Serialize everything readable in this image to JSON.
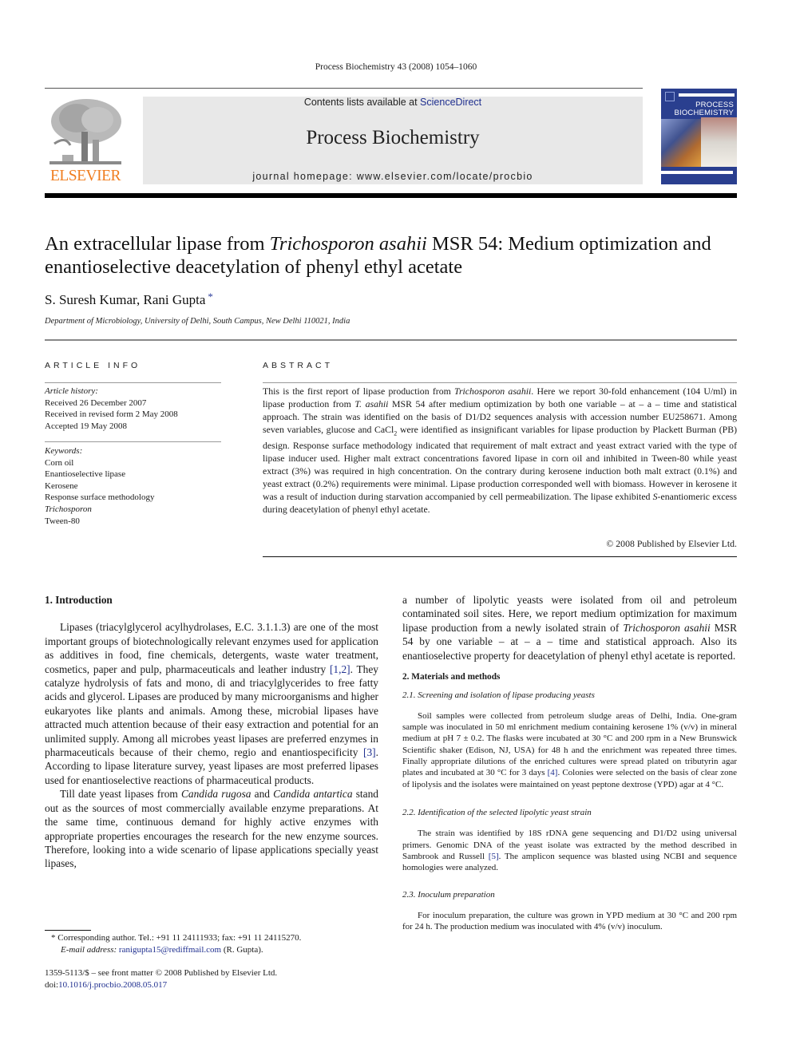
{
  "running_head": "Process Biochemistry 43 (2008) 1054–1060",
  "masthead": {
    "publisher_logo_text": "ELSEVIER",
    "contents_prefix": "Contents lists available at ",
    "contents_link": "ScienceDirect",
    "journal_name": "Process Biochemistry",
    "homepage_label": "journal homepage: www.elsevier.com/locate/procbio",
    "cover": {
      "title_line1": "PROCESS",
      "title_line2": "BIOCHEMISTRY"
    },
    "colors": {
      "elsevier_orange": "#f07d1f",
      "cover_blue": "#2a3f8f",
      "link_blue": "#1f2f8f"
    }
  },
  "article": {
    "title_part1": "An extracellular lipase from ",
    "title_italic": "Trichosporon asahii",
    "title_part2": " MSR 54: Medium optimization and enantioselective deacetylation of phenyl ethyl acetate",
    "authors": "S. Suresh Kumar, Rani Gupta",
    "corresponding_mark": "*",
    "affiliation": "Department of Microbiology, University of Delhi, South Campus, New Delhi 110021, India"
  },
  "article_info": {
    "heading": "ARTICLE INFO",
    "history_label": "Article history:",
    "history": [
      "Received 26 December 2007",
      "Received in revised form 2 May 2008",
      "Accepted 19 May 2008"
    ],
    "keywords_label": "Keywords:",
    "keywords": [
      "Corn oil",
      "Enantioselective lipase",
      "Kerosene",
      "Response surface methodology",
      "Trichosporon",
      "Tween-80"
    ]
  },
  "abstract": {
    "heading": "ABSTRACT",
    "s1": "This is the first report of lipase production from ",
    "s1_it": "Trichosporon asahii",
    "s2": ". Here we report 30-fold enhancement (104 U/ml) in lipase production from ",
    "s2_it": "T. asahii",
    "s3": " MSR 54 after medium optimization by both one variable – at – a – time and statistical approach. The strain was identified on the basis of D1/D2 sequences analysis with accession number EU258671. Among seven variables, glucose and CaCl",
    "s3_sub": "2",
    "s4": " were identified as insignificant variables for lipase production by Plackett Burman (PB) design. Response surface methodology indicated that requirement of malt extract and yeast extract varied with the type of lipase inducer used. Higher malt extract concentrations favored lipase in corn oil and inhibited in Tween-80 while yeast extract (3%) was required in high concentration. On the contrary during kerosene induction both malt extract (0.1%) and yeast extract (0.2%) requirements were minimal. Lipase production corresponded well with biomass. However in kerosene it was a result of induction during starvation accompanied by cell permeabilization. The lipase exhibited ",
    "s4_it": "S",
    "s5": "-enantiomeric excess during deacetylation of phenyl ethyl acetate.",
    "copyright": "© 2008 Published by Elsevier Ltd."
  },
  "body": {
    "intro_heading": "1.  Introduction",
    "intro_p1_a": "Lipases (triacylglycerol acylhydrolases, E.C. 3.1.1.3) are one of the most important groups of biotechnologically relevant enzymes used for application as additives in food, fine chemicals, detergents, waste water treatment, cosmetics, paper and pulp, pharmaceuticals and leather industry ",
    "intro_p1_ref1": "[1,2]",
    "intro_p1_b": ". They catalyze hydrolysis of fats and mono, di and triacylglycerides to free fatty acids and glycerol. Lipases are produced by many microorganisms and higher eukaryotes like plants and animals. Among these, microbial lipases have attracted much attention because of their easy extraction and potential for an unlimited supply. Among all microbes yeast lipases are preferred enzymes in pharmaceuticals because of their chemo, regio and enantiospecificity ",
    "intro_p1_ref2": "[3]",
    "intro_p1_c": ". According to lipase literature survey, yeast lipases are most preferred lipases used for enantioselective reactions of pharmaceutical products.",
    "intro_p2_a": "Till date yeast lipases from ",
    "intro_p2_it1": "Candida rugosa",
    "intro_p2_b": " and ",
    "intro_p2_it2": "Candida antartica",
    "intro_p2_c": " stand out as the sources of most commercially available enzyme preparations. At the same time, continuous demand for highly active enzymes with appropriate properties encourages the research for the new enzyme sources. Therefore, looking into a wide scenario of lipase applications specially yeast lipases,",
    "right_p1_a": "a number of lipolytic yeasts were isolated from oil and petroleum contaminated soil sites. Here, we report medium optimization for maximum lipase production from a newly isolated strain of ",
    "right_p1_it": "Trichosporon asahii",
    "right_p1_b": " MSR 54 by one variable – at – a – time and statistical approach. Also its enantioselective property for deacetylation of phenyl ethyl acetate is reported.",
    "methods_heading": "2.  Materials and methods",
    "sub21_heading": "2.1.  Screening and isolation of lipase producing yeasts",
    "sub21_a": "Soil samples were collected from petroleum sludge areas of Delhi, India. One-gram sample was inoculated in 50 ml enrichment medium containing kerosene 1% (v/v) in mineral medium at pH 7 ± 0.2. The flasks were incubated at 30 °C and 200 rpm in a New Brunswick Scientific shaker (Edison, NJ, USA) for 48 h and the enrichment was repeated three times. Finally appropriate dilutions of the enriched cultures were spread plated on tributyrin agar plates and incubated at 30 °C for 3 days ",
    "sub21_ref": "[4]",
    "sub21_b": ". Colonies were selected on the basis of clear zone of lipolysis and the isolates were maintained on yeast peptone dextrose (YPD) agar at 4 °C.",
    "sub22_heading": "2.2.  Identification of the selected lipolytic yeast strain",
    "sub22_a": "The strain was identified by 18S rDNA gene sequencing and D1/D2 using universal primers. Genomic DNA of the yeast isolate was extracted by the method described in Sambrook and Russell ",
    "sub22_ref": "[5]",
    "sub22_b": ". The amplicon sequence was blasted using NCBI and sequence homologies were analyzed.",
    "sub23_heading": "2.3.  Inoculum preparation",
    "sub23_text": "For inoculum preparation, the culture was grown in YPD medium at 30 °C and 200 rpm for 24 h. The production medium was inoculated with 4% (v/v) inoculum."
  },
  "footnote": {
    "mark": "*",
    "corresponding": " Corresponding author. Tel.: +91 11 24111933; fax: +91 11 24115270.",
    "email_label": "E-mail address:",
    "email": "ranigupta15@rediffmail.com",
    "email_suffix": " (R. Gupta)."
  },
  "front_matter": {
    "issn_line": "1359-5113/$ – see front matter © 2008 Published by Elsevier Ltd.",
    "doi_prefix": "doi:",
    "doi": "10.1016/j.procbio.2008.05.017"
  }
}
